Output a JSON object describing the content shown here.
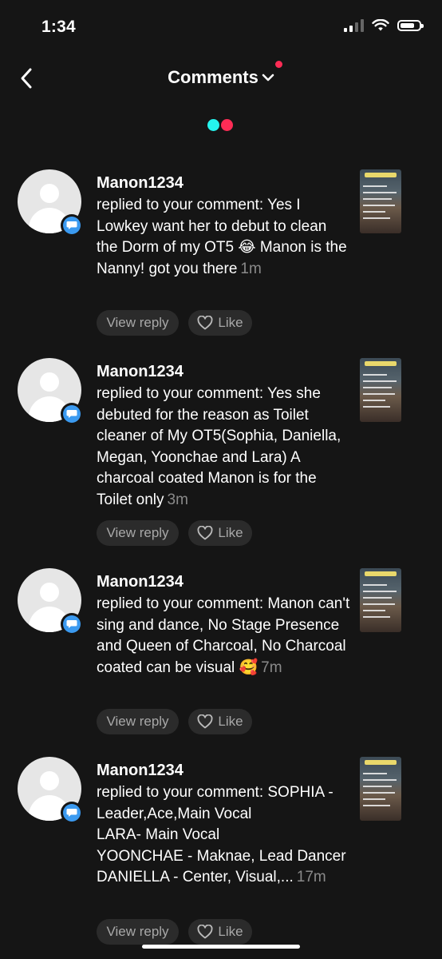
{
  "status": {
    "time": "1:34",
    "battery_level": 0.75
  },
  "header": {
    "title": "Comments"
  },
  "colors": {
    "tiktok_cyan": "#25f4ee",
    "tiktok_red": "#fe2c55",
    "badge_blue": "#3b9af0"
  },
  "comments": [
    {
      "user": "Manon1234",
      "text": "replied to your comment: Yes I Lowkey want her to debut to clean the Dorm of my OT5 😂 Manon is the Nanny! got you there",
      "time": "1m",
      "reply_label": "View reply",
      "like_label": "Like"
    },
    {
      "user": "Manon1234",
      "text": "replied to your comment: Yes she debuted for the reason as Toilet cleaner of My OT5(Sophia, Daniella, Megan, Yoonchae and Lara) A charcoal coated Manon is for the Toilet only",
      "time": "3m",
      "reply_label": "View reply",
      "like_label": "Like"
    },
    {
      "user": "Manon1234",
      "text": "replied to your comment: Manon can't sing and dance, No Stage Presence and Queen of Charcoal, No Charcoal coated can be visual 🥰",
      "time": "7m",
      "reply_label": "View reply",
      "like_label": "Like"
    },
    {
      "user": "Manon1234",
      "text": "replied to your comment: SOPHIA - Leader,Ace,Main Vocal\nLARA- Main Vocal\nYOONCHAE - Maknae, Lead Dancer\nDANIELLA - Center, Visual,...",
      "time": "17m",
      "reply_label": "View reply",
      "like_label": "Like"
    }
  ]
}
